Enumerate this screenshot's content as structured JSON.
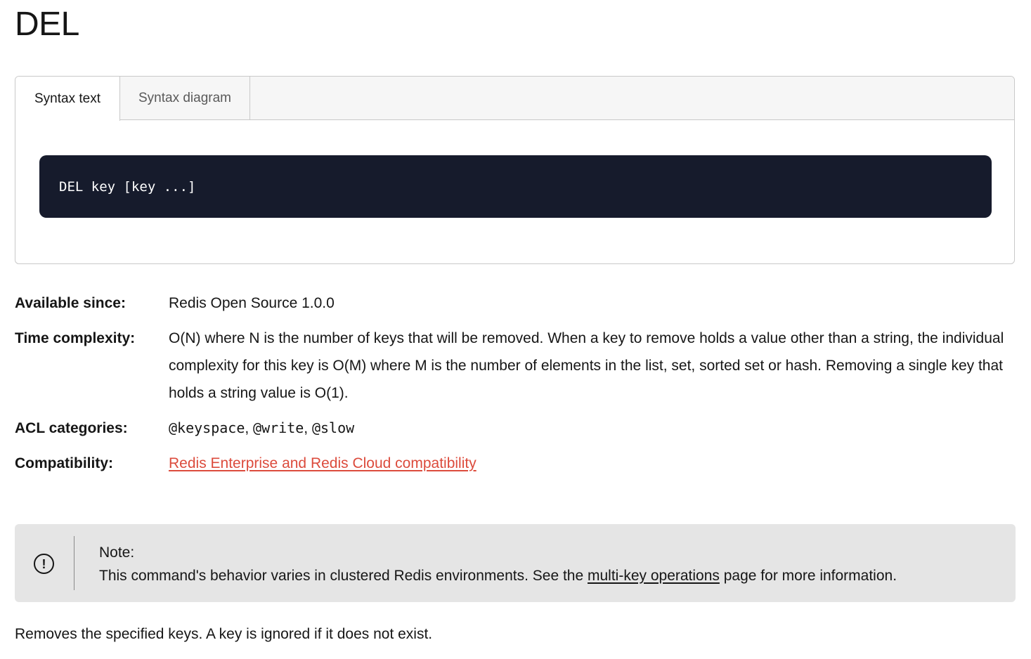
{
  "page": {
    "title": "DEL"
  },
  "tabs": {
    "syntax_text": "Syntax text",
    "syntax_diagram": "Syntax diagram"
  },
  "syntax": {
    "code": "DEL key [key ...]"
  },
  "info": {
    "available_since_label": "Available since:",
    "available_since_value": "Redis Open Source 1.0.0",
    "time_complexity_label": "Time complexity:",
    "time_complexity_value": "O(N) where N is the number of keys that will be removed. When a key to remove holds a value other than a string, the individual complexity for this key is O(M) where M is the number of elements in the list, set, sorted set or hash. Removing a single key that holds a string value is O(1).",
    "acl_label": "ACL categories:",
    "acl_categories": [
      "@keyspace",
      "@write",
      "@slow"
    ],
    "acl_separator": ", ",
    "compatibility_label": "Compatibility:",
    "compatibility_link": "Redis Enterprise and Redis Cloud compatibility"
  },
  "note": {
    "icon": "exclamation-circle-icon",
    "title": "Note:",
    "text_before": "This command's behavior varies in clustered Redis environments. See the ",
    "link_text": "multi-key operations",
    "text_after": " page for more information."
  },
  "description": "Removes the specified keys. A key is ignored if it does not exist.",
  "colors": {
    "code_background": "#161b2c",
    "link_accent": "#dc4b3c",
    "note_background": "#e5e5e5"
  }
}
